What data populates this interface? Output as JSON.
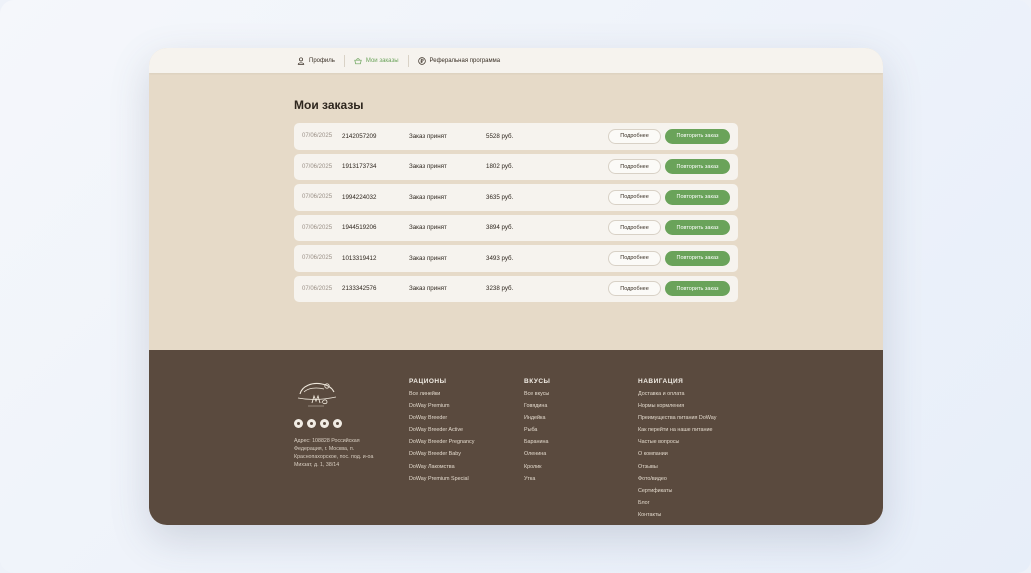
{
  "nav": {
    "items": [
      {
        "label": "Профиль",
        "icon": "user-icon",
        "active": false
      },
      {
        "label": "Мои заказы",
        "icon": "basket-icon",
        "active": true
      },
      {
        "label": "Реферальная программа",
        "icon": "ruble-icon",
        "active": false
      }
    ]
  },
  "page": {
    "title": "Мои заказы"
  },
  "orders": [
    {
      "date": "07/06/2025",
      "number": "2142057209",
      "status": "Заказ принят",
      "price": "5528 руб."
    },
    {
      "date": "07/06/2025",
      "number": "1913173734",
      "status": "Заказ принят",
      "price": "1802 руб."
    },
    {
      "date": "07/06/2025",
      "number": "1994224032",
      "status": "Заказ принят",
      "price": "3635 руб."
    },
    {
      "date": "07/06/2025",
      "number": "1944519206",
      "status": "Заказ принят",
      "price": "3894 руб."
    },
    {
      "date": "07/06/2025",
      "number": "1013319412",
      "status": "Заказ принят",
      "price": "3493 руб."
    },
    {
      "date": "07/06/2025",
      "number": "2133342576",
      "status": "Заказ принят",
      "price": "3238 руб."
    }
  ],
  "buttons": {
    "more": "Подробнее",
    "repeat": "Повторить заказ"
  },
  "footer": {
    "address": "Адрес: 108828 Российская Федерация, г. Москва, п. Краснопахорское, пос. под. и-оа Михзат, д. 1, 38/14",
    "socials": [
      "vk-icon",
      "ok-icon",
      "telegram-icon",
      "whatsapp-icon"
    ],
    "rations": {
      "title": "РАЦИОНЫ",
      "items": [
        "Все линейки",
        "DoWay Premium",
        "DoWay Breeder",
        "DoWay Breeder Active",
        "DoWay Breeder Pregnancy",
        "DoWay Breeder Baby",
        "DoWay Лакомства",
        "DoWay Premium Special"
      ]
    },
    "tastes": {
      "title": "ВКУСЫ",
      "items": [
        "Все вкусы",
        "Говядина",
        "Индейка",
        "Рыба",
        "Баранина",
        "Оленина",
        "Кролик",
        "Утка"
      ]
    },
    "navigation": {
      "title": "НАВИГАЦИЯ",
      "items": [
        "Доставка и оплата",
        "Нормы кормления",
        "Преимущества питания DoWay",
        "Как перейти на наше питание",
        "Частые вопросы",
        "О компании",
        "Отзывы",
        "Фото/видео",
        "Сертификаты",
        "Блог",
        "Контакты"
      ]
    }
  },
  "colors": {
    "accent": "#6aa35a",
    "footer_bg": "#5a4a3e",
    "main_bg": "#e6dac8",
    "card_bg": "#f6f3ee"
  }
}
